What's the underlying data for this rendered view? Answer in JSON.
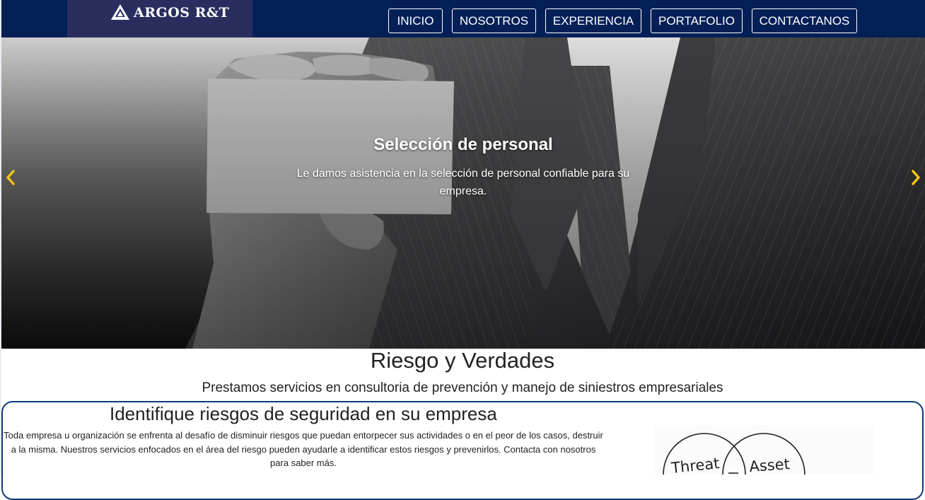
{
  "brand": {
    "name": "ARGOS R&T"
  },
  "nav": {
    "items": [
      {
        "label": "INICIO"
      },
      {
        "label": "NOSOTROS"
      },
      {
        "label": "EXPERIENCIA"
      },
      {
        "label": "PORTAFOLIO"
      },
      {
        "label": "CONTACTANOS"
      }
    ]
  },
  "hero": {
    "title": "Selección de personal",
    "text": "Le damos asistencia en la selección de personal confiable para su empresa.",
    "prev_icon": "chevron-left-icon",
    "next_icon": "chevron-right-icon",
    "arrow_color": "#f0c419"
  },
  "intro": {
    "title": "Riesgo y Verdades",
    "subtitle": "Prestamos servicios en consultoria de prevención y manejo de siniestros empresariales"
  },
  "card": {
    "title": "Identifique riesgos de seguridad en su empresa",
    "text": "Toda empresa u organización se enfrenta al desafío de disminuir riesgos que puedan entorpecer sus actividades o en el peor de los casos, destruir a la misma. Nuestros servicios enfocados en el área del riesgo pueden ayudarle a identificar estos riesgos y prevenirlos. Contacta con nosotros para saber más.",
    "diagram_labels": [
      "Threat",
      "Asset"
    ]
  },
  "colors": {
    "navbar": "#052057",
    "brand_bg": "#2a2e5e",
    "card_border": "#0d3b77"
  }
}
